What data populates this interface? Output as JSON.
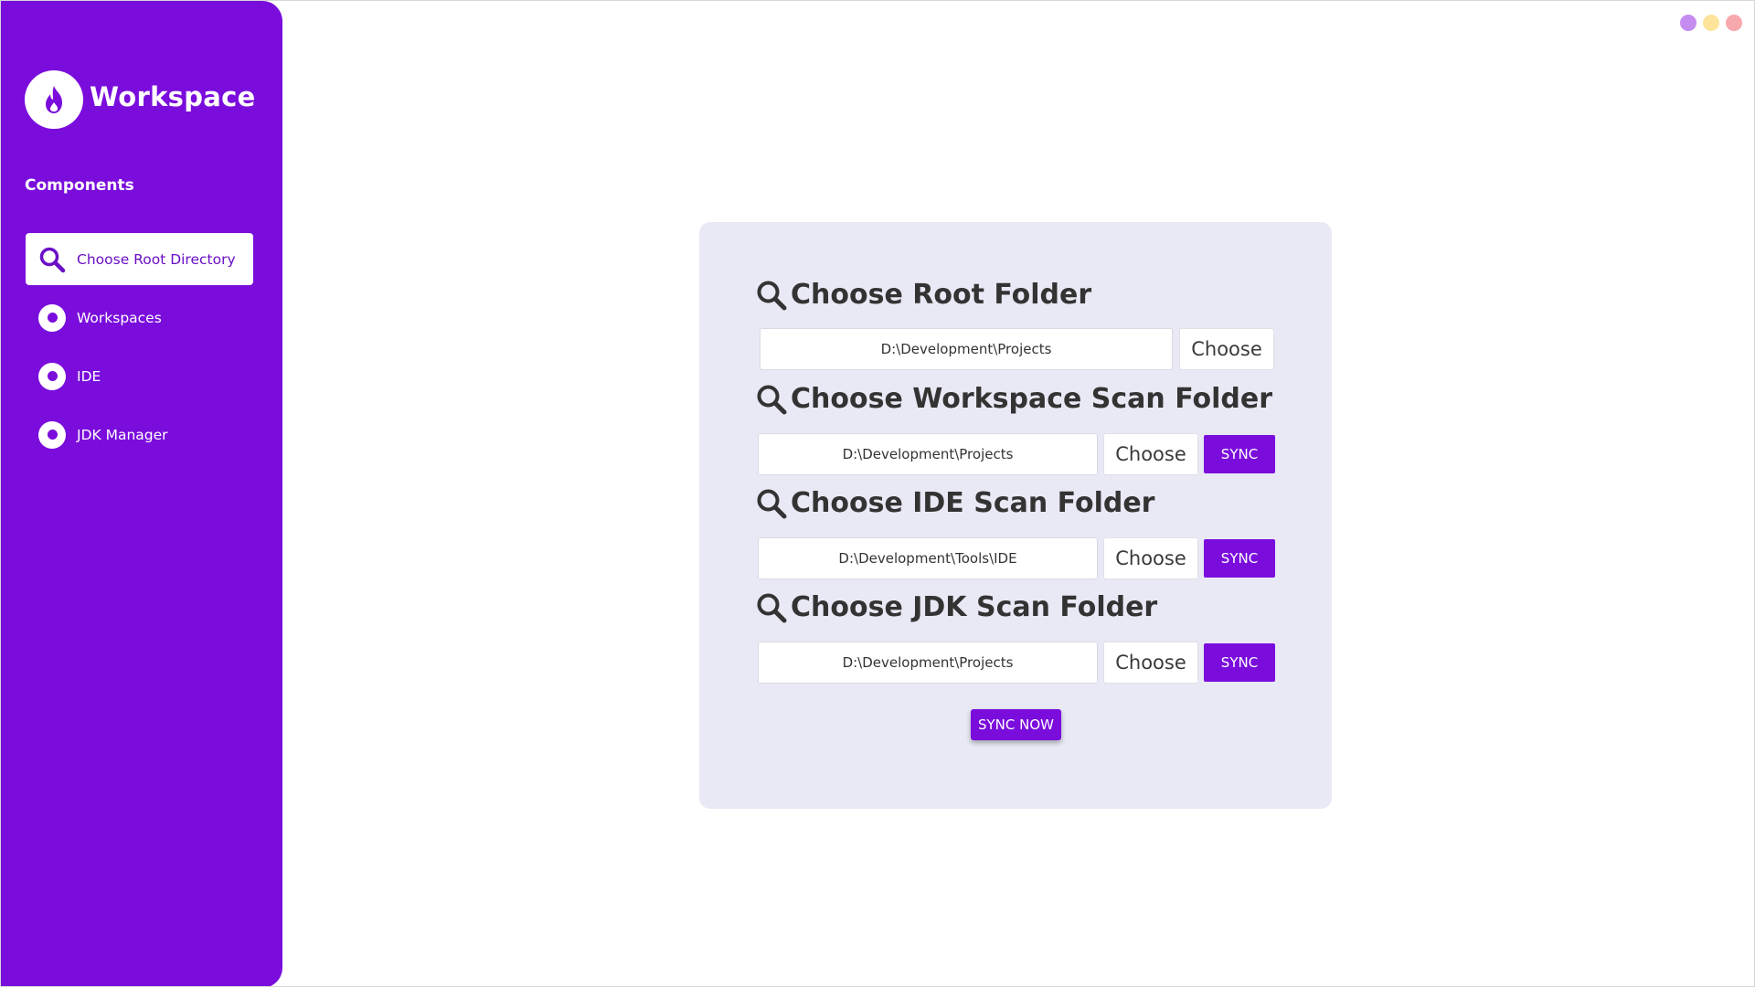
{
  "colors": {
    "accent": "#7a0ddc",
    "card_background": "#e8e9f4",
    "window_dot_1": "#c58cef",
    "window_dot_2": "#fde49a",
    "window_dot_3": "#f6a8ad"
  },
  "sidebar": {
    "brand": "Workspace",
    "logo_icon": "flame-icon",
    "section_title": "Components",
    "items": [
      {
        "label": "Choose Root Directory",
        "icon": "search-icon",
        "active": true
      },
      {
        "label": "Workspaces",
        "icon": "radio-dot-icon",
        "active": false
      },
      {
        "label": "IDE",
        "icon": "radio-dot-icon",
        "active": false
      },
      {
        "label": "JDK Manager",
        "icon": "radio-dot-icon",
        "active": false
      }
    ]
  },
  "main": {
    "sections": [
      {
        "title": "Choose Root Folder",
        "path": "D:\\Development\\Projects",
        "choose_label": "Choose"
      },
      {
        "title": "Choose Workspace Scan Folder",
        "path": "D:\\Development\\Projects",
        "choose_label": "Choose",
        "sync_label": "SYNC"
      },
      {
        "title": "Choose IDE Scan Folder",
        "path": "D:\\Development\\Tools\\IDE",
        "choose_label": "Choose",
        "sync_label": "SYNC"
      },
      {
        "title": "Choose JDK Scan Folder",
        "path": "D:\\Development\\Projects",
        "choose_label": "Choose",
        "sync_label": "SYNC"
      }
    ],
    "sync_now_label": "SYNC NOW"
  }
}
